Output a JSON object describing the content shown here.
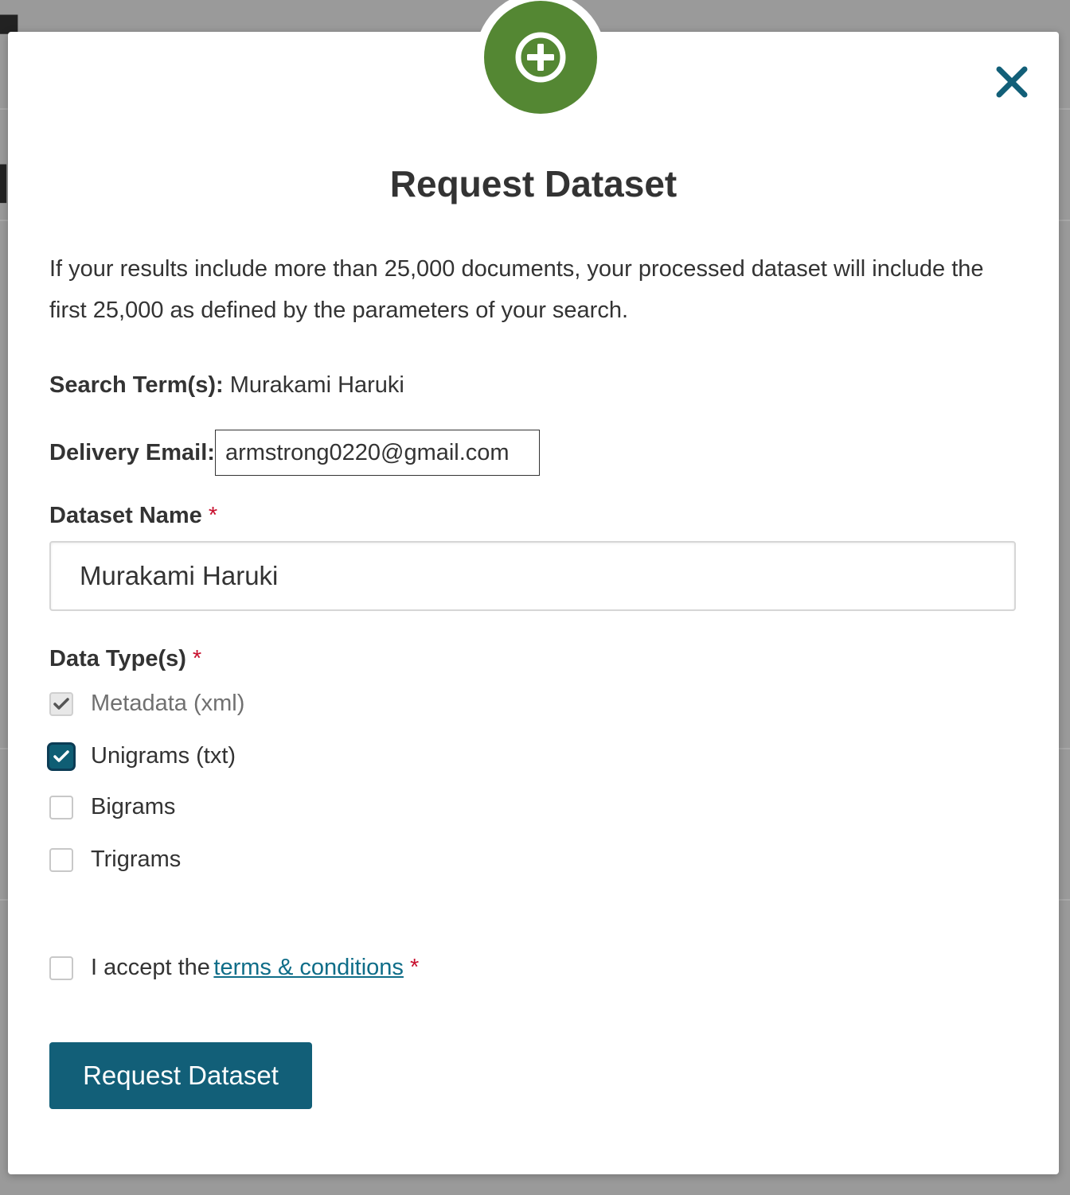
{
  "modal": {
    "title": "Request Dataset",
    "intro": "If your results include more than 25,000 documents, your processed dataset will include the first 25,000 as defined by the parameters of your search.",
    "badge_icon": "plus-circle-icon",
    "close_icon": "close-icon"
  },
  "search": {
    "label": "Search Term(s):",
    "value": "Murakami Haruki"
  },
  "email": {
    "label": "Delivery Email:",
    "value": "armstrong0220@gmail.com"
  },
  "dataset_name": {
    "label": "Dataset Name",
    "required_mark": "*",
    "value": "Murakami Haruki"
  },
  "data_types": {
    "label": "Data Type(s)",
    "required_mark": "*",
    "options": [
      {
        "label": "Metadata (xml)",
        "checked": true,
        "disabled": true
      },
      {
        "label": "Unigrams (txt)",
        "checked": true,
        "disabled": false
      },
      {
        "label": "Bigrams",
        "checked": false,
        "disabled": false
      },
      {
        "label": "Trigrams",
        "checked": false,
        "disabled": false
      }
    ]
  },
  "terms": {
    "prefix": "I accept the",
    "link": "terms & conditions",
    "required_mark": "*",
    "checked": false
  },
  "submit": {
    "label": "Request Dataset"
  },
  "colors": {
    "accent": "#125f78",
    "badge": "#548733",
    "required": "#c8102e",
    "link": "#0f6d88"
  }
}
